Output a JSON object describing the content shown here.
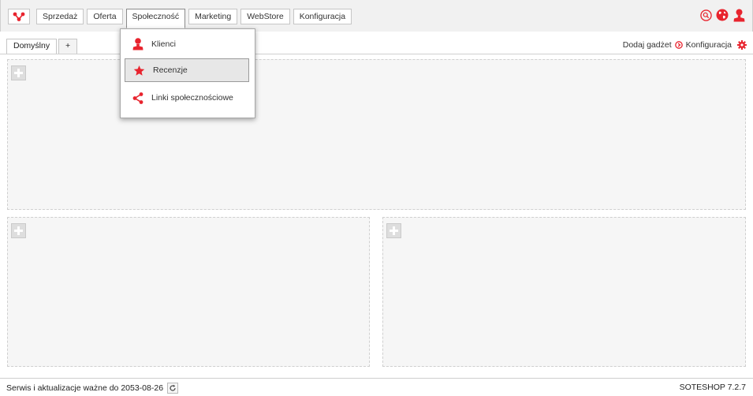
{
  "nav": {
    "items": [
      "Sprzedaż",
      "Oferta",
      "Społeczność",
      "Marketing",
      "WebStore",
      "Konfiguracja"
    ],
    "active": "Społeczność"
  },
  "tabs": {
    "default": "Domyślny",
    "add": "+"
  },
  "toolbar_right": {
    "add_gadget": "Dodaj gadżet",
    "configuration": "Konfiguracja"
  },
  "dropdown": {
    "items": [
      {
        "label": "Klienci",
        "icon": "user-icon"
      },
      {
        "label": "Recenzje",
        "icon": "star-icon"
      },
      {
        "label": "Linki społecznościowe",
        "icon": "share-icon"
      }
    ],
    "hovered": "Recenzje"
  },
  "footer": {
    "license": "Serwis i aktualizacje ważne do 2053-08-26",
    "version": "SOTESHOP 7.2.7"
  },
  "colors": {
    "accent": "#e8242e",
    "zone_bg": "#f6f6f6",
    "topbar_bg": "#f1f1f1"
  }
}
